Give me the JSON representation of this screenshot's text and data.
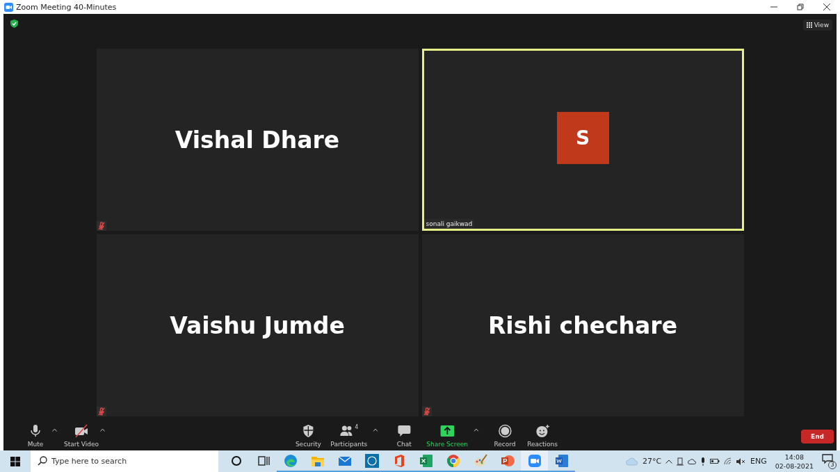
{
  "window": {
    "title": "Zoom Meeting 40-Minutes"
  },
  "top_bar": {
    "encrypted": true,
    "view_button": "View"
  },
  "tiles": [
    {
      "kind": "name",
      "name": "Vishal Dhare",
      "muted": true,
      "active_speaker": false
    },
    {
      "kind": "avatar",
      "initial": "S",
      "name": "sonali gaikwad",
      "color": "#c1391b",
      "muted": false,
      "active_speaker": true
    },
    {
      "kind": "name",
      "name": "Vaishu Jumde",
      "muted": true,
      "active_speaker": false
    },
    {
      "kind": "name",
      "name": "Rishi chechare",
      "muted": true,
      "active_speaker": false
    }
  ],
  "toolbar": {
    "left": [
      {
        "kind": "mic",
        "label": "Mute",
        "caret": true
      },
      {
        "kind": "video-off",
        "label": "Start Video",
        "caret": true
      }
    ],
    "center": [
      {
        "kind": "security",
        "label": "Security",
        "caret": false
      },
      {
        "kind": "participants",
        "label": "Participants",
        "count": "4",
        "caret": true
      },
      {
        "kind": "chat",
        "label": "Chat",
        "caret": false
      },
      {
        "kind": "share",
        "label": "Share Screen",
        "caret": true
      },
      {
        "kind": "record",
        "label": "Record",
        "caret": false
      },
      {
        "kind": "reactions",
        "label": "Reactions",
        "caret": false
      }
    ],
    "end_button": "End"
  },
  "taskbar": {
    "search": {
      "placeholder": "Type here to search"
    },
    "apps": [
      {
        "kind": "cortana",
        "running": false,
        "selected": false
      },
      {
        "kind": "taskview",
        "running": false,
        "selected": false
      },
      {
        "kind": "edge",
        "running": true,
        "selected": false
      },
      {
        "kind": "explorer",
        "running": true,
        "selected": false
      },
      {
        "kind": "mail",
        "running": true,
        "selected": false
      },
      {
        "kind": "dell",
        "running": true,
        "selected": false
      },
      {
        "kind": "office",
        "running": true,
        "selected": false
      },
      {
        "kind": "excel",
        "running": true,
        "selected": false
      },
      {
        "kind": "chrome",
        "running": true,
        "selected": false
      },
      {
        "kind": "paint",
        "running": true,
        "selected": false
      },
      {
        "kind": "powerpoint",
        "running": true,
        "selected": false
      },
      {
        "kind": "zoom",
        "running": true,
        "selected": true
      },
      {
        "kind": "word",
        "running": true,
        "selected": false
      }
    ],
    "weather": "27°C",
    "language": "ENG",
    "time": "14:08",
    "date": "02-08-2021",
    "notifications": "3"
  }
}
